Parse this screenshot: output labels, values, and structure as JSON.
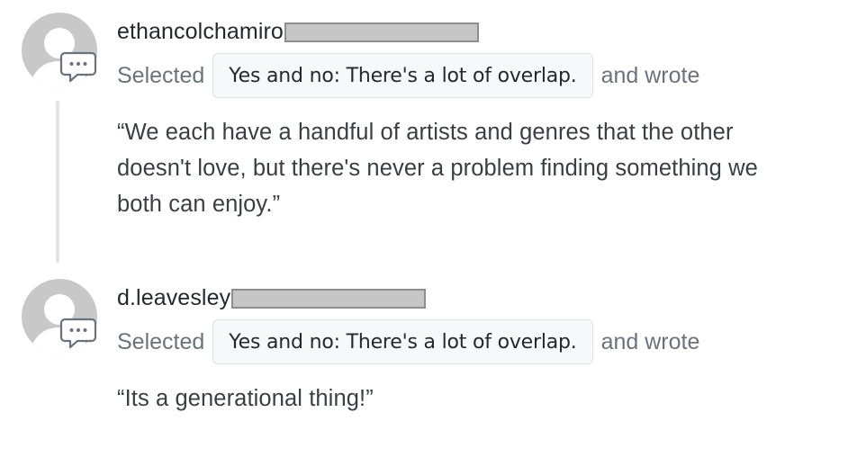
{
  "comments": [
    {
      "username": "ethancolchamiro",
      "selected_label": "Selected",
      "choice": "Yes and no: There's a lot of overlap.",
      "wrote_label": "and wrote",
      "quote": "“We each have a handful of artists and genres that the other doesn't love, but there's never a problem finding something we both can enjoy.”"
    },
    {
      "username": "d.leavesley",
      "selected_label": "Selected",
      "choice": "Yes and no: There's a lot of overlap.",
      "wrote_label": "and wrote",
      "quote": "“Its a generational thing!”"
    }
  ],
  "icons": {
    "avatar": "default-avatar-icon",
    "badge": "comment-bubble-icon"
  },
  "colors": {
    "avatar_gray": "#c8c8c8",
    "chip_background": "#f6f8fa",
    "muted_text": "#6a737d",
    "thread_line": "#e1e4e8"
  }
}
